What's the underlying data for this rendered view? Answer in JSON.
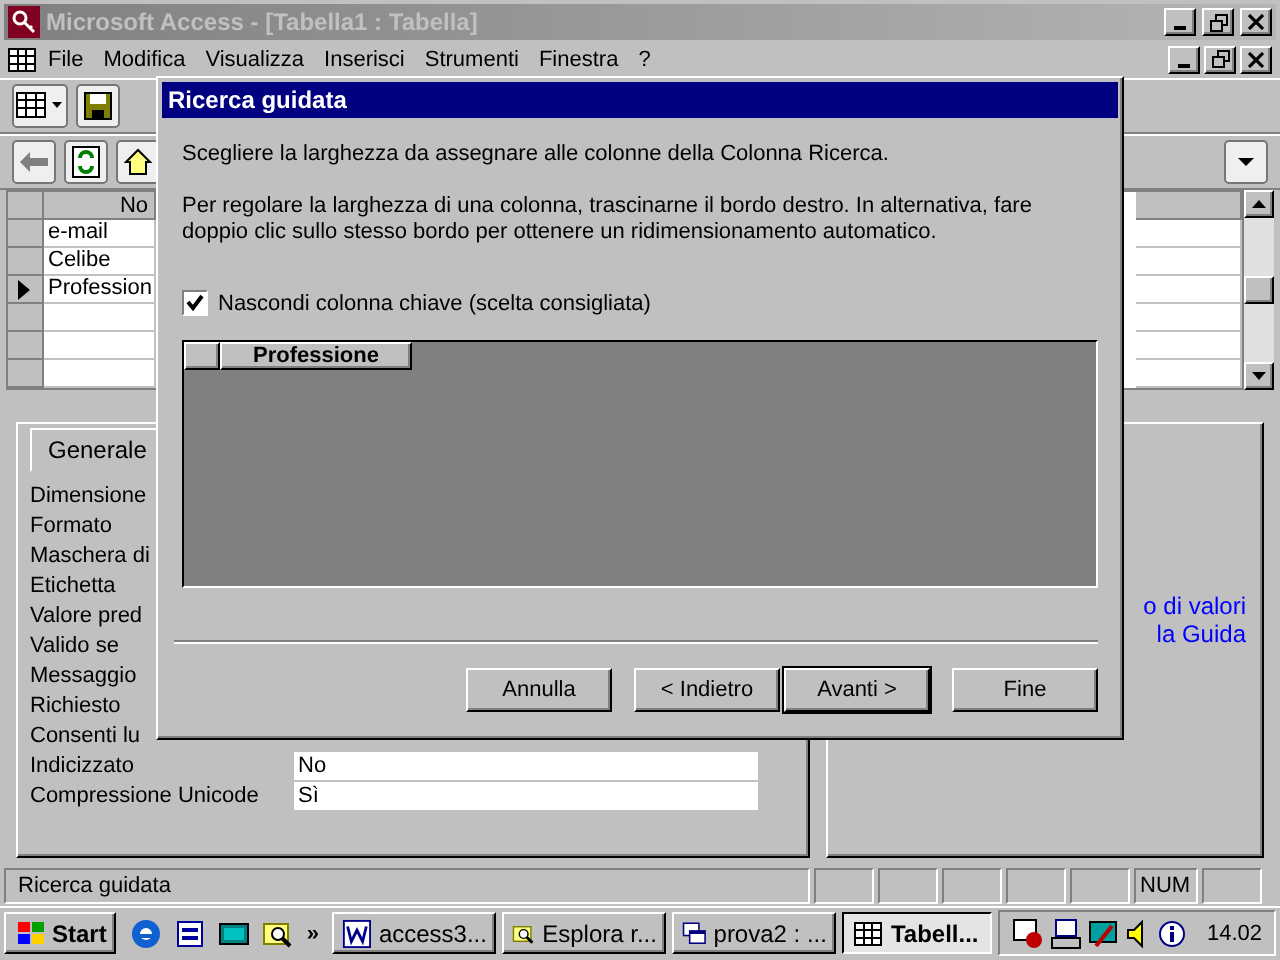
{
  "window": {
    "title": "Microsoft Access - [Tabella1 : Tabella]",
    "active": false
  },
  "menu": [
    "File",
    "Modifica",
    "Visualizza",
    "Inserisci",
    "Strumenti",
    "Finestra",
    "?"
  ],
  "datasheet": {
    "column": "No",
    "rows": [
      {
        "value": "e-mail",
        "current": false
      },
      {
        "value": "Celibe",
        "current": false
      },
      {
        "value": "Profession",
        "current": true
      },
      {
        "current": false
      },
      {
        "current": false
      },
      {
        "current": false
      }
    ]
  },
  "properties": {
    "tabs": [
      {
        "label": "Generale",
        "selected": true
      }
    ],
    "rows": [
      {
        "label": "Dimensione"
      },
      {
        "label": "Formato"
      },
      {
        "label": "Maschera di"
      },
      {
        "label": "Etichetta"
      },
      {
        "label": "Valore pred"
      },
      {
        "label": "Valido se"
      },
      {
        "label": "Messaggio"
      },
      {
        "label": "Richiesto"
      },
      {
        "label": "Consenti lu"
      },
      {
        "label": "Indicizzato",
        "value": "No"
      },
      {
        "label": "Compressione Unicode",
        "value": "Sì"
      }
    ]
  },
  "help_text": [
    "o di valori",
    "la Guida"
  ],
  "status_bar": {
    "text": "Ricerca guidata",
    "indicator": "NUM"
  },
  "dialog": {
    "title": "Ricerca guidata",
    "intro": "Scegliere la larghezza da assegnare alle colonne della Colonna Ricerca.",
    "instructions": "Per regolare la larghezza di una colonna, trascinarne il bordo destro. In alternativa, fare doppio clic sullo stesso bordo per ottenere un ridimensionamento automatico.",
    "hide_key": {
      "label": "Nascondi colonna chiave (scelta consigliata)",
      "checked": true
    },
    "preview_columns": [
      "Professione"
    ],
    "buttons": [
      {
        "label": "Annulla",
        "default": false
      },
      {
        "label": "< Indietro",
        "default": false
      },
      {
        "label": "Avanti >",
        "default": true
      },
      {
        "label": "Fine",
        "default": false
      }
    ]
  },
  "taskbar": {
    "start": "Start",
    "more": "»",
    "tasks": [
      {
        "kind": "word",
        "label": "access3...",
        "selected": false
      },
      {
        "kind": "explorer",
        "label": "Esplora r...",
        "selected": false
      },
      {
        "kind": "window",
        "label": "prova2 : ...",
        "selected": false
      },
      {
        "kind": "table",
        "label": "Tabell...",
        "selected": true
      }
    ],
    "clock": "14.02"
  }
}
